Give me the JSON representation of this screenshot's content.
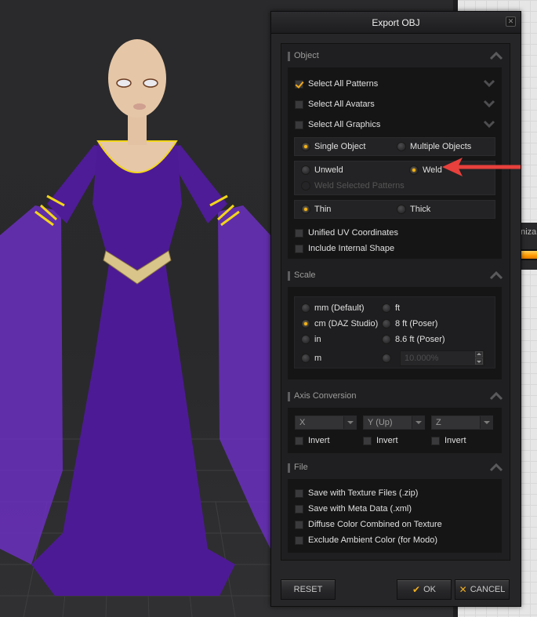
{
  "dialog": {
    "title": "Export OBJ",
    "close_icon": "close-icon"
  },
  "sections": {
    "object": {
      "title": "Object",
      "select_rows": [
        {
          "label": "Select All Patterns",
          "checked": true
        },
        {
          "label": "Select All Avatars",
          "checked": false
        },
        {
          "label": "Select All Graphics",
          "checked": false
        }
      ],
      "object_mode": {
        "options": [
          "Single Object",
          "Multiple Objects"
        ],
        "selected": "Single Object"
      },
      "weld_mode": {
        "options": [
          "Unweld",
          "Weld"
        ],
        "selected": "Weld",
        "sub_option": {
          "label": "Weld Selected Patterns",
          "enabled": false
        }
      },
      "thickness": {
        "options": [
          "Thin",
          "Thick"
        ],
        "selected": "Thin"
      },
      "checkboxes": [
        {
          "label": "Unified UV Coordinates",
          "checked": false
        },
        {
          "label": "Include Internal Shape",
          "checked": false
        }
      ]
    },
    "scale": {
      "title": "Scale",
      "options_left": [
        "mm (Default)",
        "cm (DAZ Studio)",
        "in",
        "m"
      ],
      "options_right": [
        "ft",
        "8 ft (Poser)",
        "8.6 ft (Poser)",
        ""
      ],
      "selected": "cm (DAZ Studio)",
      "custom_value": "10.000%"
    },
    "axis": {
      "title": "Axis Conversion",
      "axes": [
        {
          "value": "X",
          "invert_label": "Invert",
          "invert": false
        },
        {
          "value": "Y (Up)",
          "invert_label": "Invert",
          "invert": false
        },
        {
          "value": "Z",
          "invert_label": "Invert",
          "invert": false
        }
      ]
    },
    "file": {
      "title": "File",
      "checkboxes": [
        {
          "label": "Save with Texture Files (.zip)",
          "checked": false
        },
        {
          "label": "Save with Meta Data (.xml)",
          "checked": false
        },
        {
          "label": "Diffuse Color Combined on Texture",
          "checked": false
        },
        {
          "label": "Exclude Ambient Color (for Modo)",
          "checked": false
        }
      ]
    }
  },
  "buttons": {
    "reset": "RESET",
    "ok": "OK",
    "cancel": "CANCEL"
  },
  "background": {
    "partial_label": "oniza",
    "accent_color": "#f4b213",
    "dress_color": "#4a1a8c"
  }
}
